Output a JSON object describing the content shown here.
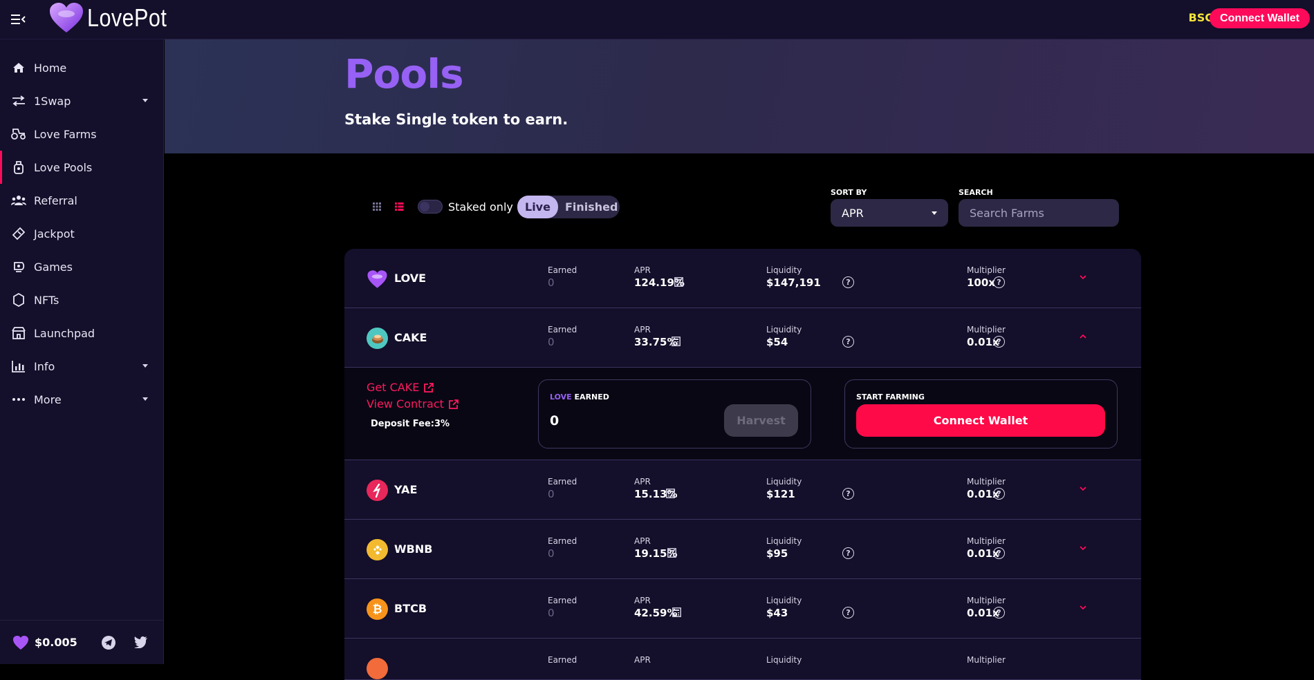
{
  "brand": {
    "name": "LovePot"
  },
  "header": {
    "network": "BSC",
    "connect_label": "Connect Wallet"
  },
  "sidebar": {
    "items": [
      {
        "label": "Home",
        "icon": "home-icon"
      },
      {
        "label": "1Swap",
        "icon": "swap-icon",
        "expandable": true
      },
      {
        "label": "Love Farms",
        "icon": "tractor-icon"
      },
      {
        "label": "Love Pools",
        "icon": "pool-icon",
        "active": true
      },
      {
        "label": "Referral",
        "icon": "users-icon"
      },
      {
        "label": "Jackpot",
        "icon": "ticket-icon"
      },
      {
        "label": "Games",
        "icon": "games-icon"
      },
      {
        "label": "NFTs",
        "icon": "nft-icon"
      },
      {
        "label": "Launchpad",
        "icon": "launchpad-icon"
      },
      {
        "label": "Info",
        "icon": "chart-icon",
        "expandable": true
      },
      {
        "label": "More",
        "icon": "more-icon",
        "expandable": true
      }
    ],
    "price": "$0.005"
  },
  "hero": {
    "title": "Pools",
    "subtitle": "Stake Single token to earn."
  },
  "controls": {
    "staked_only": "Staked only",
    "tab_live": "Live",
    "tab_finished": "Finished",
    "sort_label": "SORT BY",
    "sort_value": "APR",
    "search_label": "SEARCH",
    "search_placeholder": "Search Farms"
  },
  "labels": {
    "earned": "Earned",
    "apr": "APR",
    "liquidity": "Liquidity",
    "multiplier": "Multiplier"
  },
  "pools": [
    {
      "token": "LOVE",
      "earned": "0",
      "apr": "124.19%",
      "liquidity": "$147,191",
      "multiplier": "100x",
      "icon_color": "#a855f7"
    },
    {
      "token": "CAKE",
      "earned": "0",
      "apr": "33.75%",
      "liquidity": "$54",
      "multiplier": "0.01x",
      "icon_color": "#4fc7c1",
      "expanded": true
    },
    {
      "token": "YAE",
      "earned": "0",
      "apr": "15.13%",
      "liquidity": "$121",
      "multiplier": "0.01x",
      "icon_color": "#e8275a"
    },
    {
      "token": "WBNB",
      "earned": "0",
      "apr": "19.15%",
      "liquidity": "$95",
      "multiplier": "0.01x",
      "icon_color": "#f3ba2f"
    },
    {
      "token": "BTCB",
      "earned": "0",
      "apr": "42.59%",
      "liquidity": "$43",
      "multiplier": "0.01x",
      "icon_color": "#f7931a"
    }
  ],
  "details": {
    "get_link": "Get CAKE",
    "view_contract": "View Contract",
    "deposit_fee": "Deposit Fee:3%",
    "earned_token": "LOVE",
    "earned_suffix": "EARNED",
    "earned_value": "0",
    "harvest_label": "Harvest",
    "start_farming": "START FARMING",
    "connect_label": "Connect Wallet"
  },
  "colors": {
    "accent": "#fe0a5a",
    "purple": "#9661f4",
    "network": "#f3e33b"
  }
}
